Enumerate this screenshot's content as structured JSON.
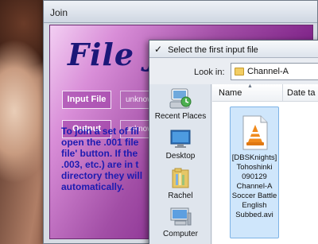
{
  "join_window": {
    "title": "Join",
    "banner": "File J",
    "input_file_button": "Input File",
    "input_file_value": "unknown",
    "output_button": "Output",
    "output_value": "unknown",
    "instructions": "To join a set of fil\nopen the .001 file\nfile' button. If the\n.003, etc.) are in t\ndirectory they will\nautomatically."
  },
  "file_dialog": {
    "title": "Select the first input file",
    "look_in_label": "Look in:",
    "look_in_value": "Channel-A",
    "places": [
      {
        "label": "Recent Places",
        "icon": "recent-places-icon"
      },
      {
        "label": "Desktop",
        "icon": "desktop-icon"
      },
      {
        "label": "Rachel",
        "icon": "user-folder-icon"
      },
      {
        "label": "Computer",
        "icon": "computer-icon"
      }
    ],
    "columns": {
      "name": "Name",
      "date": "Date ta"
    },
    "files": [
      {
        "label": "[DBSKnights]\nTohoshinki\n090129\nChannel-A\nSoccer Battle\nEnglish\nSubbed.avi",
        "icon": "vlc-media-file-icon"
      }
    ]
  },
  "colors": {
    "join_panel": "#a24ea6",
    "banner": "#1c1778",
    "instructions": "#1c1bb0",
    "selection": "#cfe6fb"
  }
}
